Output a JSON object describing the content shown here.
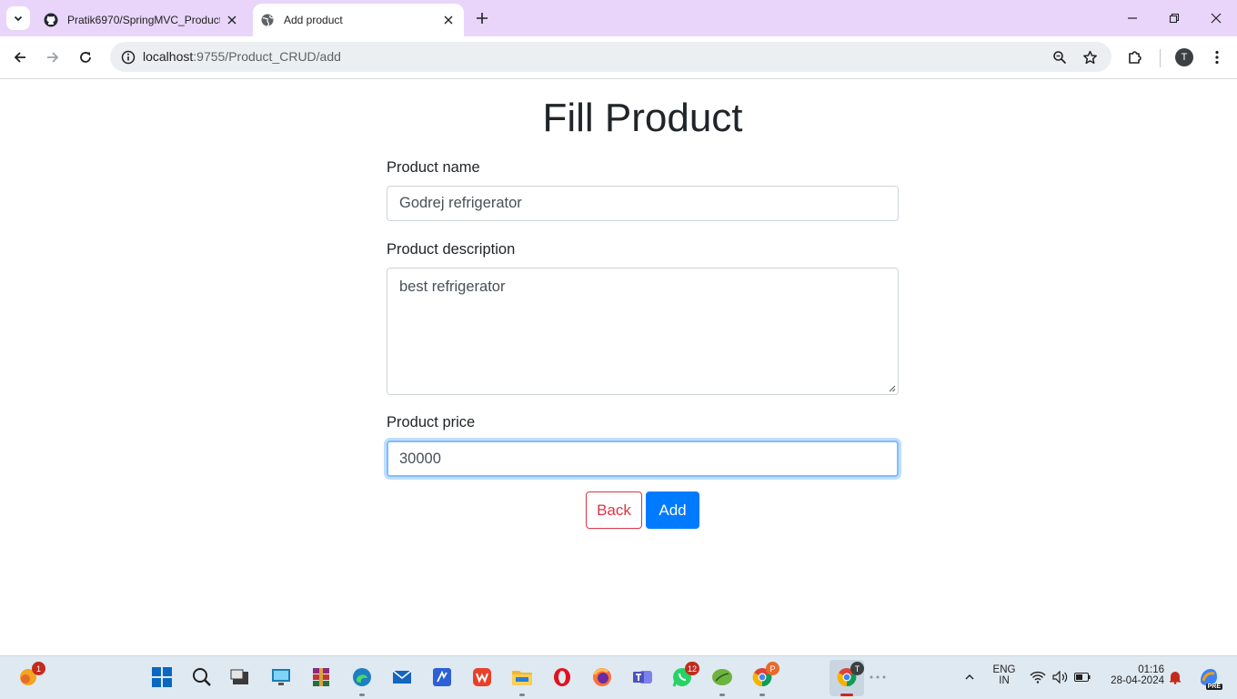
{
  "browser": {
    "tabs": [
      {
        "title": "Pratik6970/SpringMVC_Product_CRUD",
        "icon": "github-icon",
        "active": false
      },
      {
        "title": "Add product",
        "icon": "globe-icon",
        "active": true
      }
    ],
    "url_host": "localhost",
    "url_path": ":9755/Product_CRUD/add",
    "profile_initial": "T"
  },
  "form": {
    "title": "Fill Product",
    "name_label": "Product name",
    "name_value": "Godrej refrigerator",
    "description_label": "Product description",
    "description_value": "best refrigerator",
    "price_label": "Product price",
    "price_value": "30000",
    "back_label": "Back",
    "add_label": "Add"
  },
  "taskbar": {
    "widgets_badge": "1",
    "whatsapp_badge": "12",
    "chrome_p_badge": "P",
    "chrome_t_badge": "T",
    "lang_line1": "ENG",
    "lang_line2": "IN",
    "time": "01:16",
    "date": "28-04-2024",
    "copilot_label": "PRE"
  },
  "colors": {
    "tabstrip": "#e9d5f9",
    "primary": "#007bff",
    "danger": "#dc3545",
    "focus": "#80bdff"
  }
}
